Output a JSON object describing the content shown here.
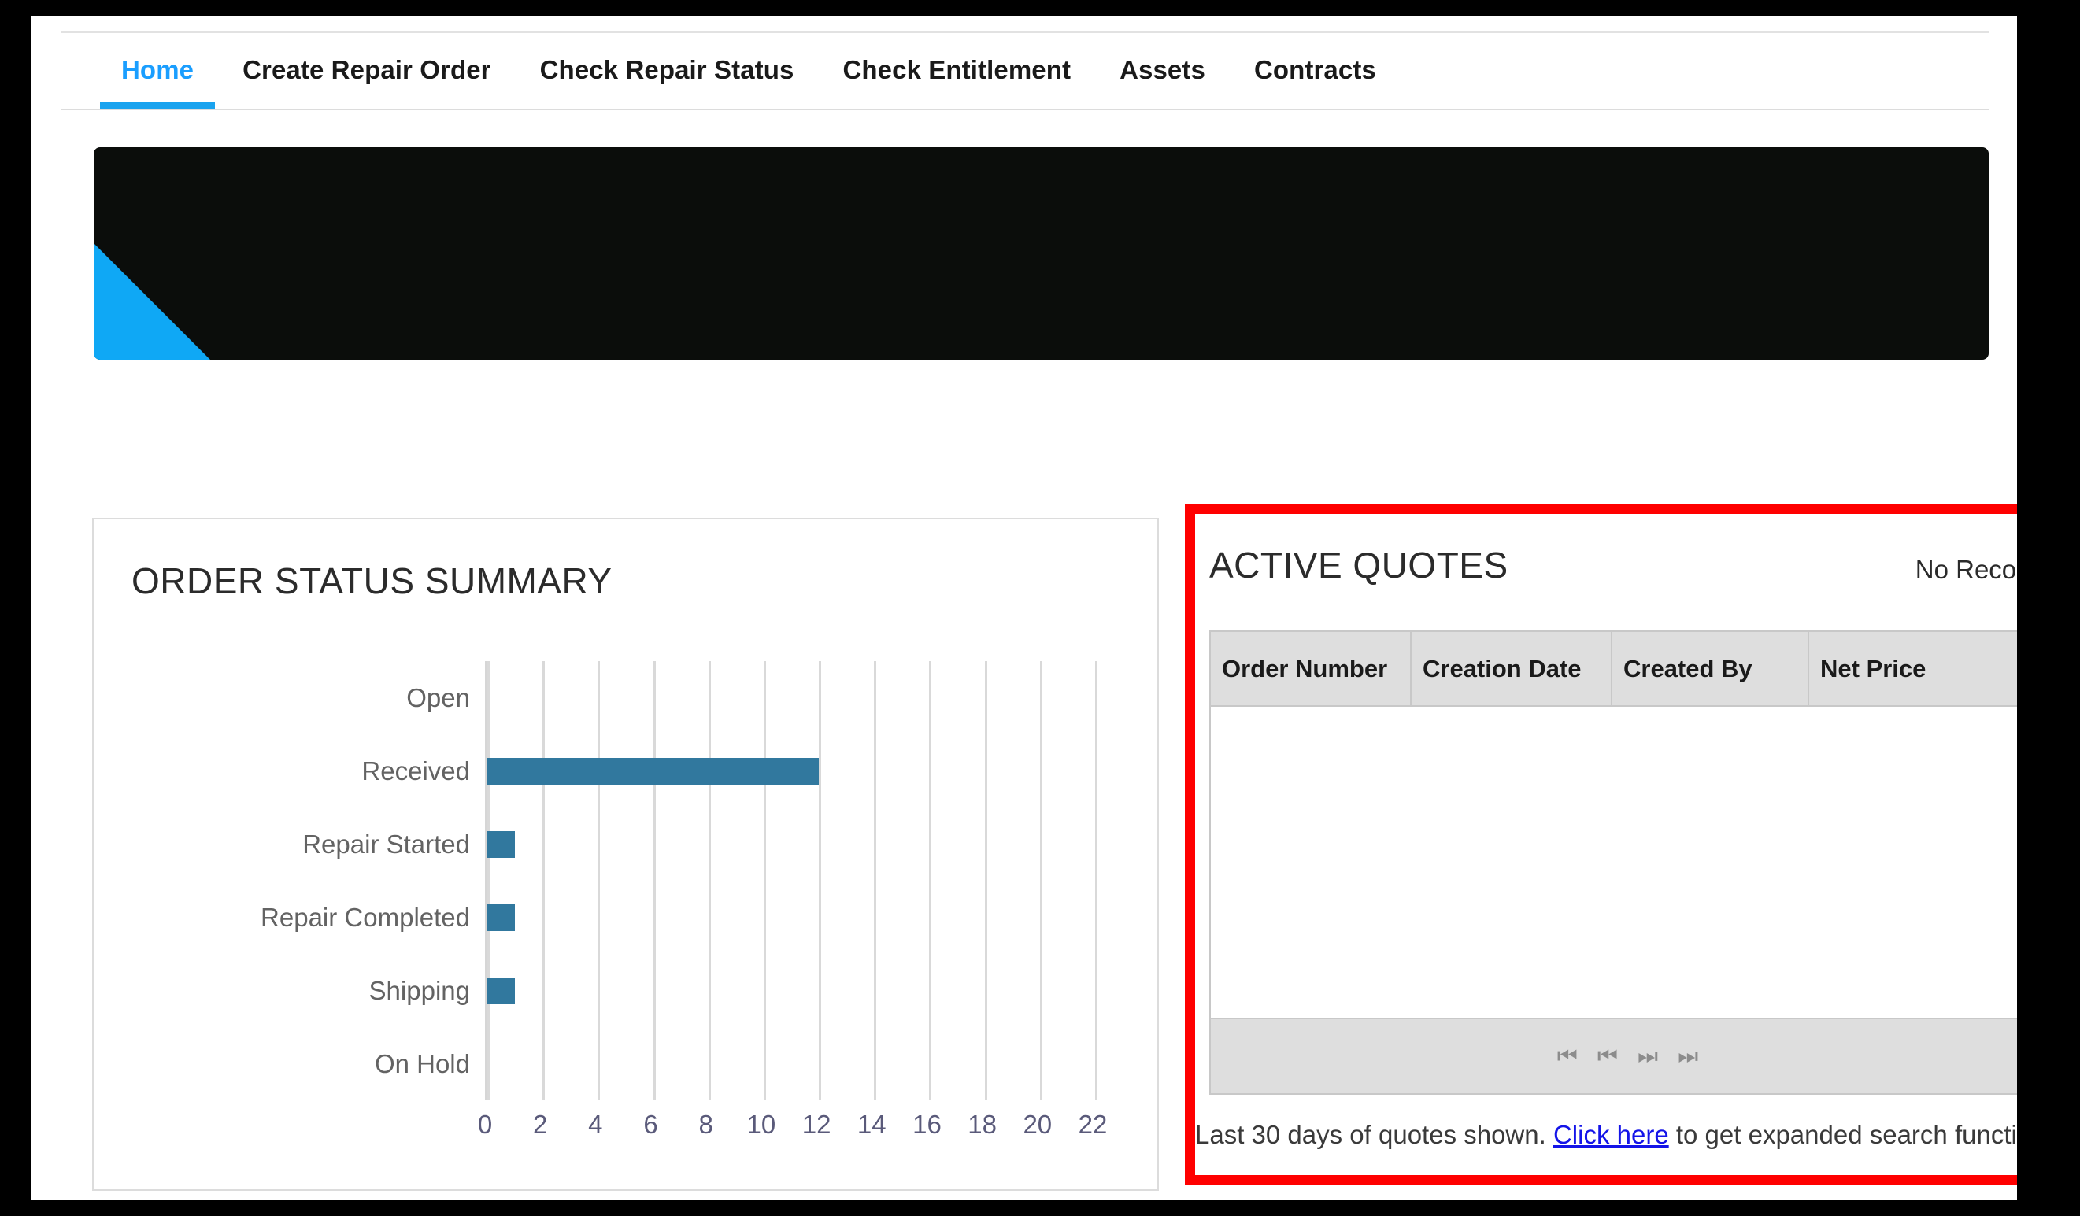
{
  "nav": {
    "tabs": [
      {
        "label": "Home",
        "active": true
      },
      {
        "label": "Create Repair Order",
        "active": false
      },
      {
        "label": "Check Repair Status",
        "active": false
      },
      {
        "label": "Check Entitlement",
        "active": false
      },
      {
        "label": "Assets",
        "active": false
      },
      {
        "label": "Contracts",
        "active": false
      }
    ]
  },
  "hero": {
    "background_color": "#0b0d0b",
    "accent_color": "#0fa8f5"
  },
  "order_status": {
    "title": "ORDER STATUS SUMMARY"
  },
  "chart_data": {
    "type": "bar",
    "orientation": "horizontal",
    "title": "ORDER STATUS SUMMARY",
    "categories": [
      "Open",
      "Received",
      "Repair Started",
      "Repair Completed",
      "Shipping",
      "On Hold"
    ],
    "values": [
      0,
      12,
      1,
      1,
      1,
      0
    ],
    "xlabel": "",
    "ylabel": "",
    "xlim": [
      0,
      22
    ],
    "xticks": [
      0,
      2,
      4,
      6,
      8,
      10,
      12,
      14,
      16,
      18,
      20,
      22
    ],
    "xtick_labels": [
      "0",
      "2",
      "4",
      "6",
      "8",
      "10",
      "12",
      "14",
      "16",
      "18",
      "20",
      "22"
    ],
    "grid": true,
    "legend": false,
    "bar_color": "#31789e"
  },
  "active_quotes": {
    "title": "ACTIVE QUOTES",
    "record_status": "No Records",
    "columns": [
      "Order Number",
      "Creation Date",
      "Created By",
      "Net Price"
    ],
    "rows": [],
    "pager": [
      {
        "name": "first-page",
        "glyph": "⏮"
      },
      {
        "name": "previous-page",
        "glyph": "«"
      },
      {
        "name": "next-page",
        "glyph": "»"
      },
      {
        "name": "last-page",
        "glyph": "⏭"
      }
    ],
    "footer": {
      "text_before": "Last 30 days of quotes shown. ",
      "link_text": "Click here",
      "text_after": " to get expanded search function."
    },
    "highlight_color": "#ff0000"
  }
}
